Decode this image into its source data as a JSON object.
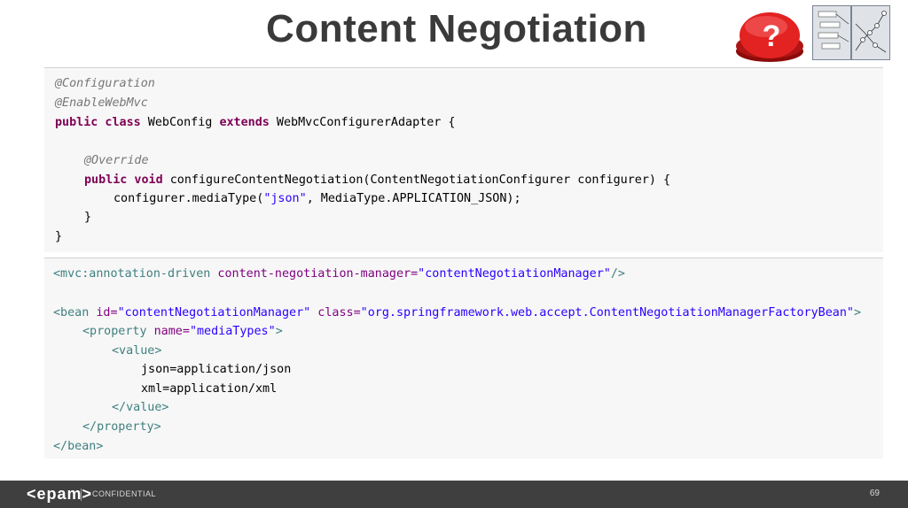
{
  "slide": {
    "title": "Content Negotiation",
    "page_number": "69"
  },
  "java_code": {
    "l1": "@Configuration",
    "l2": "@EnableWebMvc",
    "l3_kw": "public class",
    "l3_a": " WebConfig ",
    "l3_kw2": "extends",
    "l3_b": " WebMvcConfigurerAdapter {",
    "l5": "@Override",
    "l6_kw": "public void",
    "l6_rest": " configureContentNegotiation(ContentNegotiationConfigurer configurer) {",
    "l7_a": "configurer.mediaType(",
    "l7_str": "\"json\"",
    "l7_b": ", MediaType.APPLICATION_JSON);",
    "l8": "}",
    "l9": "}"
  },
  "xml_code": {
    "l1_tag": "<mvc:annotation-driven",
    "l1_attr": " content-negotiation-manager=",
    "l1_val": "\"contentNegotiationManager\"",
    "l1_end": "/>",
    "l3_tag": "<bean",
    "l3_attr1": " id=",
    "l3_val1": "\"contentNegotiationManager\"",
    "l3_attr2": " class=",
    "l3_val2": "\"org.springframework.web.accept.ContentNegotiationManagerFactoryBean\"",
    "l3_end": ">",
    "l4_tag": "<property",
    "l4_attr": " name=",
    "l4_val": "\"mediaTypes\"",
    "l4_end": ">",
    "l5": "<value>",
    "l6": "json=application/json",
    "l7": "xml=application/xml",
    "l8": "</value>",
    "l9": "</property>",
    "l10": "</bean>"
  },
  "footer": {
    "logo": "<epam>",
    "confidential": "CONFIDENTIAL"
  },
  "icons": {
    "question": "?"
  }
}
